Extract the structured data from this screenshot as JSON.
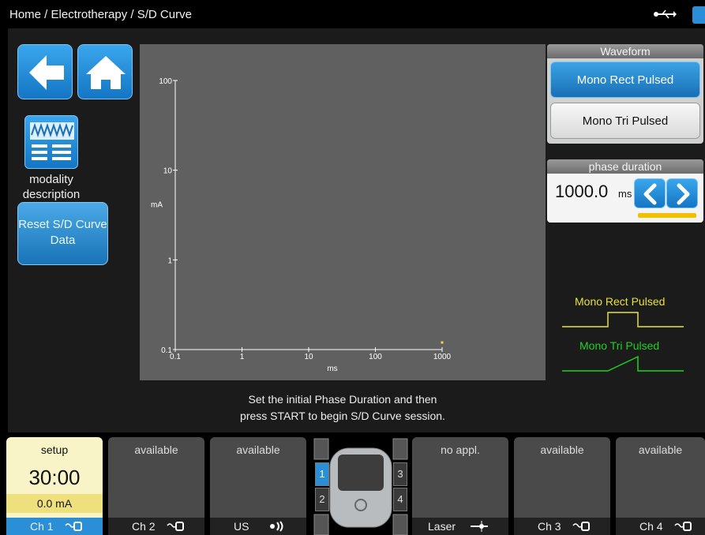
{
  "header": {
    "breadcrumb": "Home / Electrotherapy / S/D Curve",
    "usb_icon": "usb-icon",
    "storage_icon": "storage-icon"
  },
  "nav": {
    "back_icon": "back-arrow-icon",
    "home_icon": "home-icon"
  },
  "modality": {
    "icon": "modality-description-icon",
    "label_line1": "modality",
    "label_line2": "description"
  },
  "reset": {
    "label_line1": "Reset S/D Curve",
    "label_line2": "Data"
  },
  "chart_data": {
    "type": "scatter",
    "x_scale": "log",
    "y_scale": "log",
    "xlabel": "ms",
    "ylabel": "mA",
    "x_ticks": [
      "0.1",
      "1",
      "10",
      "100",
      "1000"
    ],
    "y_ticks": [
      "100",
      "10",
      "1",
      "0.1"
    ],
    "xlim": [
      0.1,
      1000
    ],
    "ylim": [
      0.1,
      100
    ],
    "points": [
      {
        "x": 1000,
        "y": 0.12
      }
    ],
    "point_color": "#e6e13a"
  },
  "waveform": {
    "header": "Waveform",
    "options": [
      "Mono Rect Pulsed",
      "Mono Tri Pulsed"
    ],
    "selected": "Mono Rect Pulsed"
  },
  "phase_duration": {
    "header": "phase duration",
    "value": "1000.0",
    "unit": "ms",
    "decrease_icon": "chevron-left-icon",
    "increase_icon": "chevron-right-icon"
  },
  "legend": {
    "rect_label": "Mono Rect Pulsed",
    "tri_label": "Mono Tri Pulsed",
    "rect_color": "#e6e13a",
    "tri_color": "#1fd11f"
  },
  "instructions": {
    "line1": "Set the initial Phase Duration and then",
    "line2": "press START to begin S/D Curve session."
  },
  "channels": {
    "ch1": {
      "title": "setup",
      "time": "30:00",
      "amp": "0.0 mA",
      "name": "Ch 1"
    },
    "ch2": {
      "title": "available",
      "name": "Ch 2"
    },
    "us": {
      "title": "available",
      "name": "US"
    },
    "laser": {
      "title": "no appl.",
      "name": "Laser"
    },
    "ch3": {
      "title": "available",
      "name": "Ch 3"
    },
    "ch4": {
      "title": "available",
      "name": "Ch 4"
    },
    "device_slots": [
      "1",
      "2",
      "3",
      "4"
    ]
  }
}
